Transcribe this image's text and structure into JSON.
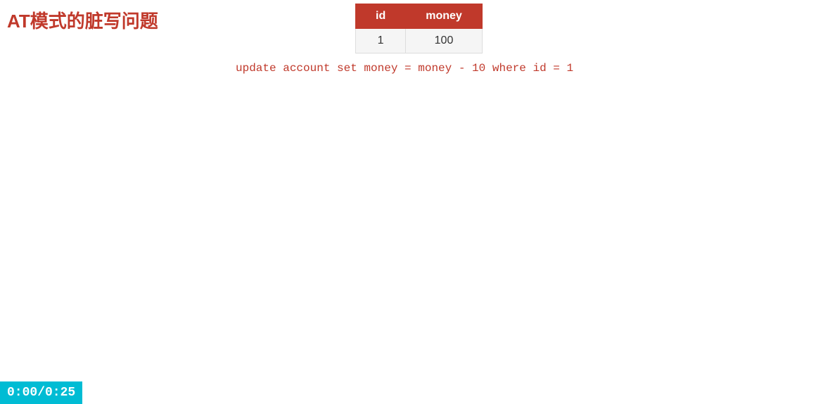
{
  "page": {
    "title": "AT模式的脏写问题",
    "background": "#ffffff"
  },
  "table": {
    "headers": [
      "id",
      "money"
    ],
    "rows": [
      {
        "id": "1",
        "money": "100"
      }
    ]
  },
  "sql": {
    "text": "update account set money = money - 10 where id = 1"
  },
  "timer": {
    "label": "0:00/0:25"
  }
}
